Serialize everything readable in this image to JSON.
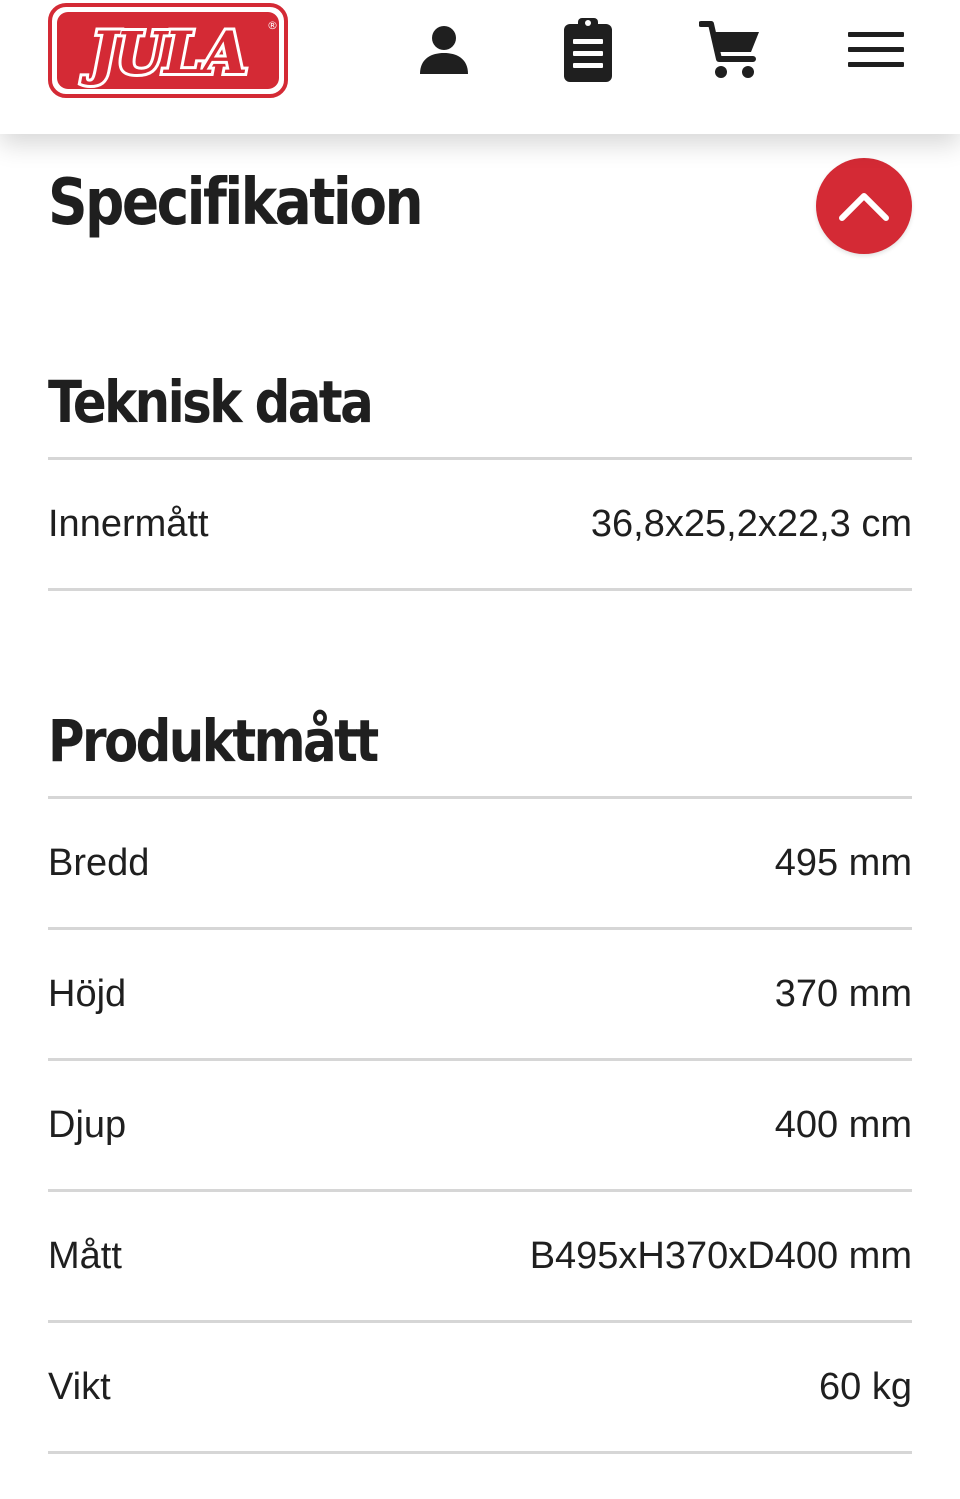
{
  "header": {
    "logo_text": "JULA",
    "logo_registered": "®",
    "icons": [
      "account-icon",
      "shopping-list-icon",
      "cart-icon",
      "menu-icon"
    ]
  },
  "specification": {
    "title": "Specifikation",
    "toggle_icon": "chevron-up-icon",
    "accent_color": "#d42a35"
  },
  "groups": [
    {
      "title": "Teknisk data",
      "rows": [
        {
          "label": "Innermått",
          "value": "36,8x25,2x22,3 cm"
        }
      ]
    },
    {
      "title": "Produktmått",
      "rows": [
        {
          "label": "Bredd",
          "value": "495 mm"
        },
        {
          "label": "Höjd",
          "value": "370 mm"
        },
        {
          "label": "Djup",
          "value": "400 mm"
        },
        {
          "label": "Mått",
          "value": "B495xH370xD400 mm"
        },
        {
          "label": "Vikt",
          "value": "60 kg"
        }
      ]
    }
  ]
}
